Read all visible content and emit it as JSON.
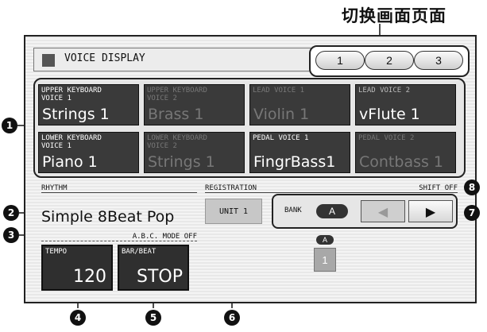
{
  "caption": "切换画面页面",
  "window": {
    "title": "VOICE DISPLAY"
  },
  "pages": [
    "1",
    "2",
    "3"
  ],
  "voices": [
    {
      "label": "UPPER KEYBOARD\nVOICE 1",
      "name": "Strings 1",
      "active": true
    },
    {
      "label": "UPPER KEYBOARD\nVOICE 2",
      "name": "Brass 1",
      "active": false
    },
    {
      "label": "LEAD VOICE 1",
      "name": "Violin 1",
      "active": false
    },
    {
      "label": "LEAD VOICE 2",
      "name": "vFlute 1",
      "active": true
    },
    {
      "label": "LOWER KEYBOARD\nVOICE 1",
      "name": "Piano 1",
      "active": true
    },
    {
      "label": "LOWER KEYBOARD\nVOICE 2",
      "name": "Strings 1",
      "active": false
    },
    {
      "label": "PEDAL VOICE 1",
      "name": "FingrBass1",
      "active": true
    },
    {
      "label": "PEDAL VOICE 2",
      "name": "Contbass 1",
      "active": false
    }
  ],
  "rhythm": {
    "header": "RHYTHM",
    "name": "Simple 8Beat Pop",
    "abc_mode": "A.B.C. MODE OFF",
    "tempo_label": "TEMPO",
    "tempo_value": "120",
    "barbeat_label": "BAR/BEAT",
    "barbeat_value": "STOP"
  },
  "registration": {
    "header": "REGISTRATION",
    "shift": "SHIFT OFF",
    "unit": "UNIT 1",
    "bank_label": "BANK",
    "bank_value": "A",
    "memory_bank": "A",
    "memory_number": "1"
  },
  "callouts": [
    "1",
    "2",
    "3",
    "4",
    "5",
    "6",
    "7",
    "8"
  ]
}
